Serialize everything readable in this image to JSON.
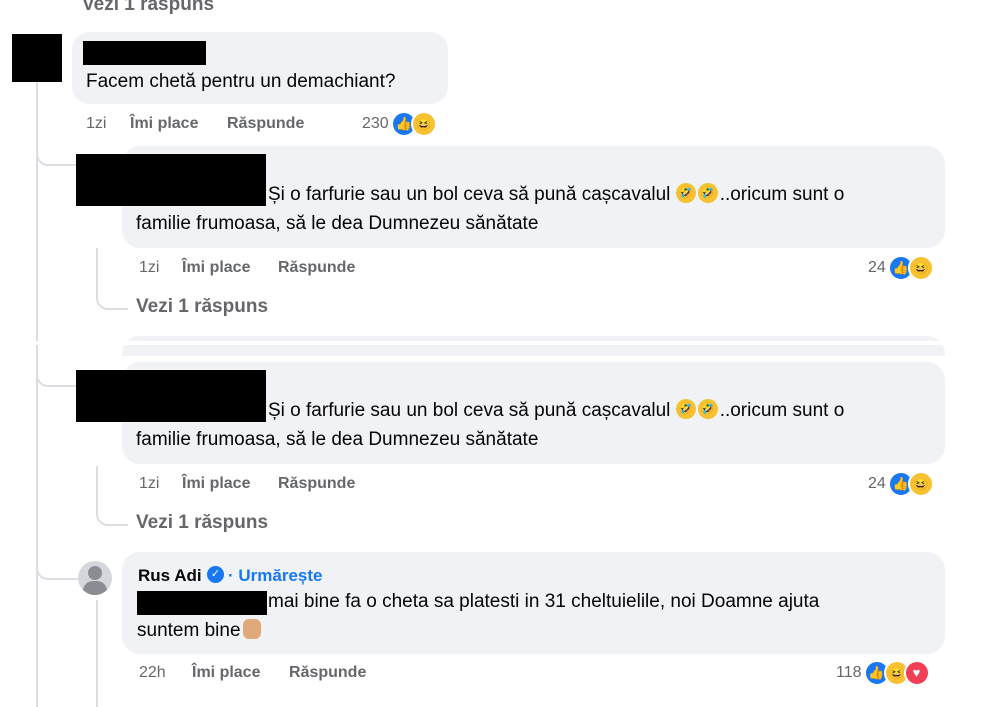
{
  "top_link": "Vezi 1 răspuns",
  "comment_main": {
    "text": "Facem chetă pentru un demachiant?",
    "time": "1zi",
    "like": "Îmi place",
    "reply": "Răspunde",
    "reaction_count": "230",
    "reaction_icons": [
      "like-icon",
      "haha-icon"
    ]
  },
  "reply_1": {
    "line1": "Și o farfurie sau un bol ceva să pună cașcavalul",
    "line1_after": "..oricum sunt o",
    "line2": "familie frumoasa, să le dea Dumnezeu sănătate",
    "time": "1zi",
    "like": "Îmi place",
    "reply": "Răspunde",
    "reaction_count": "24",
    "view_replies": "Vezi 1 răspuns"
  },
  "reply_2": {
    "line1": "Și o farfurie sau un bol ceva să pună cașcavalul",
    "line1_after": "..oricum sunt o",
    "line2": "familie frumoasa, să le dea Dumnezeu sănătate",
    "time": "1zi",
    "like": "Îmi place",
    "reply": "Răspunde",
    "reaction_count": "24",
    "view_replies": "Vezi 1 răspuns"
  },
  "reply_3": {
    "author": "Rus Adi",
    "follow": "· Urmărește",
    "line1": "mai bine fa o cheta sa platesti in 31 cheltuielile, noi Doamne ajuta",
    "line2": "suntem bine",
    "time": "22h",
    "like": "Îmi place",
    "reply": "Răspunde",
    "reaction_count": "118",
    "reaction_icons": [
      "like-icon",
      "haha-icon",
      "love-icon"
    ]
  },
  "colors": {
    "bubble": "#f0f2f5",
    "meta_text": "#65676b",
    "like_blue": "#1877f2",
    "haha_yellow": "#f7c232",
    "love_red": "#f33e58",
    "verified_blue": "#1877f2"
  }
}
